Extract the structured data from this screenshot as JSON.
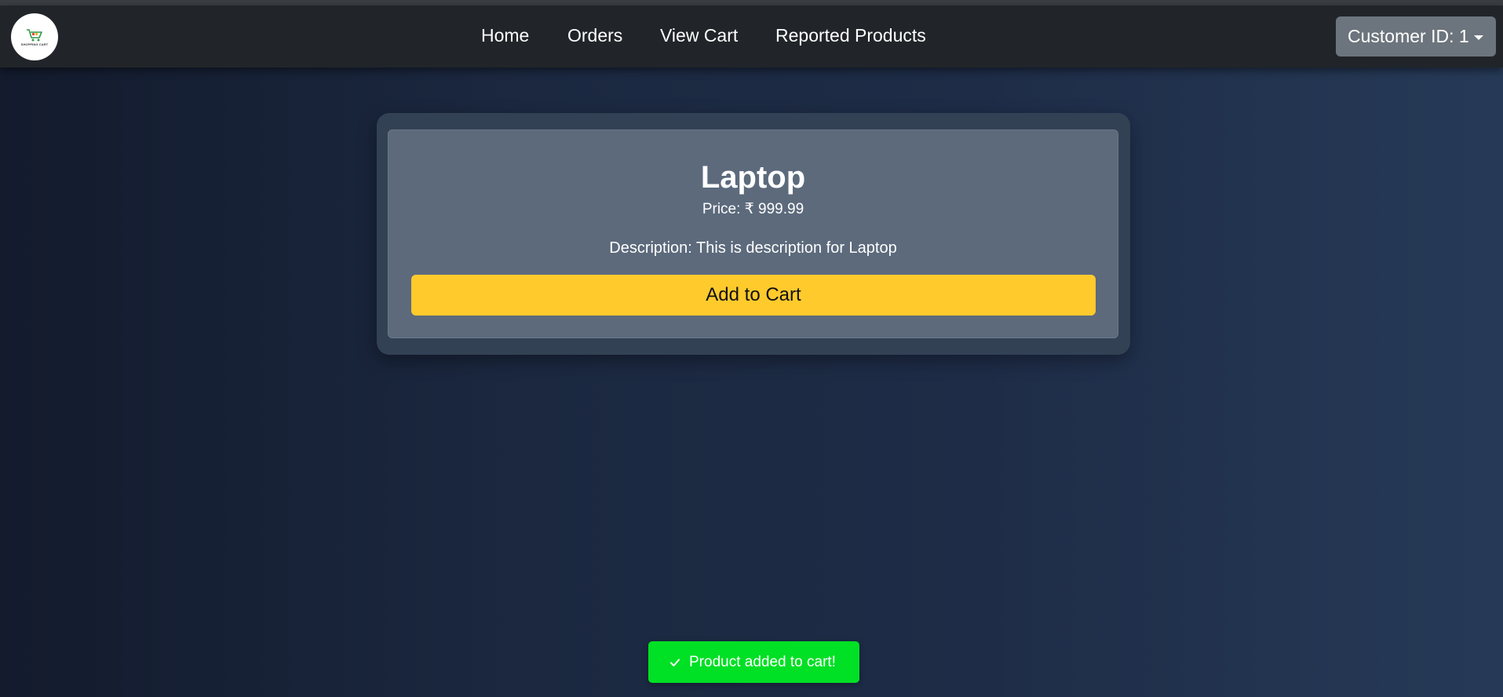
{
  "navbar": {
    "logo_icon": "shopping-cart-icon",
    "logo_text": "SHOPPING CART",
    "links": [
      {
        "label": "Home"
      },
      {
        "label": "Orders"
      },
      {
        "label": "View Cart"
      },
      {
        "label": "Reported Products"
      }
    ],
    "customer_dropdown": {
      "label": "Customer ID: 1"
    }
  },
  "product": {
    "name": "Laptop",
    "price": "Price: ₹ 999.99",
    "description": "Description: This is description for Laptop",
    "add_button_label": "Add to Cart",
    "button_color": "#ffca2c"
  },
  "toast": {
    "icon": "check-icon",
    "message": "Product added to cart!",
    "color": "#00e025"
  }
}
